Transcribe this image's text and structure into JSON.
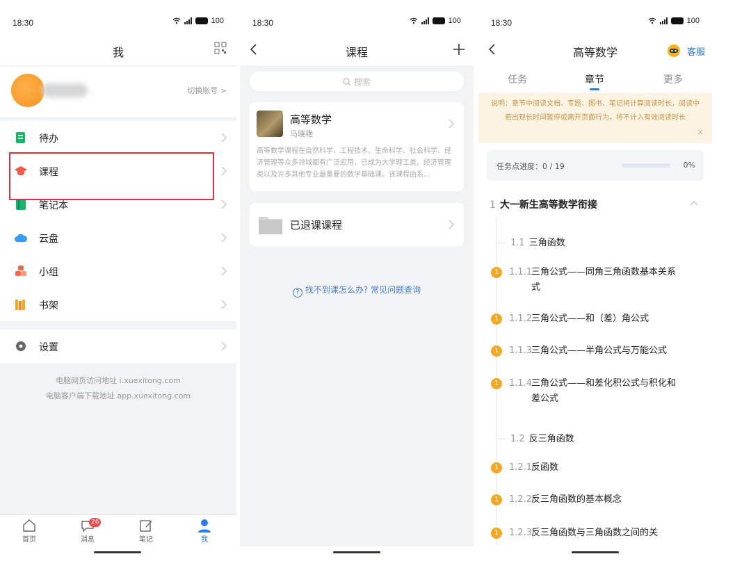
{
  "colors": {
    "accent": "#2b7bf0",
    "highlight_box": "#d8343c",
    "badge": "#f04a4a",
    "notice_bg": "#fdf3e3",
    "notice_text": "#c7964a",
    "dot": "#f5a623"
  },
  "panel1": {
    "status": {
      "time": "18:30",
      "battery": "100"
    },
    "title": "我",
    "qr_icon": "qr-code-icon",
    "profile": {
      "switch_label": "切换账号 >"
    },
    "menu": [
      {
        "label": "待办",
        "icon": "todo-icon",
        "color": "#1ab36b"
      },
      {
        "label": "课程",
        "icon": "course-cap-icon",
        "color": "#f05a4a"
      },
      {
        "label": "笔记本",
        "icon": "notebook-icon",
        "color": "#17b46d"
      },
      {
        "label": "云盘",
        "icon": "cloud-icon",
        "color": "#3a9bf5"
      },
      {
        "label": "小组",
        "icon": "group-icon",
        "color": "#f06a4a"
      },
      {
        "label": "书架",
        "icon": "bookshelf-icon",
        "color": "#f5a623"
      }
    ],
    "settings_label": "设置",
    "footer_lines": [
      "电脑网页访问地址 i.xuexitong.com",
      "电脑客户端下载地址 app.xuexitong.com"
    ],
    "tabs": [
      {
        "label": "首页",
        "icon": "home-icon"
      },
      {
        "label": "消息",
        "icon": "message-icon",
        "badge": "26"
      },
      {
        "label": "笔记",
        "icon": "note-edit-icon"
      },
      {
        "label": "我",
        "icon": "person-icon"
      }
    ]
  },
  "panel2": {
    "status": {
      "time": "18:30",
      "battery": "100"
    },
    "title": "课程",
    "search_placeholder": "搜索",
    "course": {
      "name": "高等数学",
      "teacher": "马晓艳",
      "description": "高等数学课程在自然科学、工程技术、生命科学、社会科学、经济管理等众多领域都有广泛应用，已成为大学理工类、经济管理类以及许多其他专业最重要的数学基础课。该课程由系..."
    },
    "dropped_label": "已退课课程",
    "help_text": "找不到课怎么办? 常见问题查询"
  },
  "panel3": {
    "status": {
      "time": "18:30",
      "battery": "100"
    },
    "title": "高等数学",
    "service_label": "客服",
    "tabs": [
      "任务",
      "章节",
      "更多"
    ],
    "active_tab": "章节",
    "notice": "说明：章节中阅读文档、专题、图书、笔记将计算阅读时长，阅读中若出现长时间暂停或离开页面行为，将不计入有效阅读时长",
    "progress": {
      "label": "任务点进度：0 / 19",
      "percent_text": "0%",
      "fraction": 0
    },
    "chapter": {
      "num": "1",
      "title": "大一新生高等数学衔接"
    },
    "sections": [
      {
        "num": "1.1",
        "title": "三角函数"
      },
      {
        "num": "1.2",
        "title": "反三角函数"
      }
    ],
    "items": [
      {
        "dot": "1",
        "num": "1.1.1",
        "title": "三角公式——同角三角函数基本关系式"
      },
      {
        "dot": "1",
        "num": "1.1.2",
        "title": "三角公式——和（差）角公式"
      },
      {
        "dot": "1",
        "num": "1.1.3",
        "title": "三角公式——半角公式与万能公式"
      },
      {
        "dot": "1",
        "num": "1.1.4",
        "title": "三角公式——和差化积公式与积化和差公式"
      },
      {
        "dot": "1",
        "num": "1.2.1",
        "title": "反函数"
      },
      {
        "dot": "1",
        "num": "1.2.2",
        "title": "反三角函数的基本概念"
      },
      {
        "dot": "1",
        "num": "1.2.3",
        "title": "反三角函数与三角函数之间的关"
      }
    ]
  }
}
